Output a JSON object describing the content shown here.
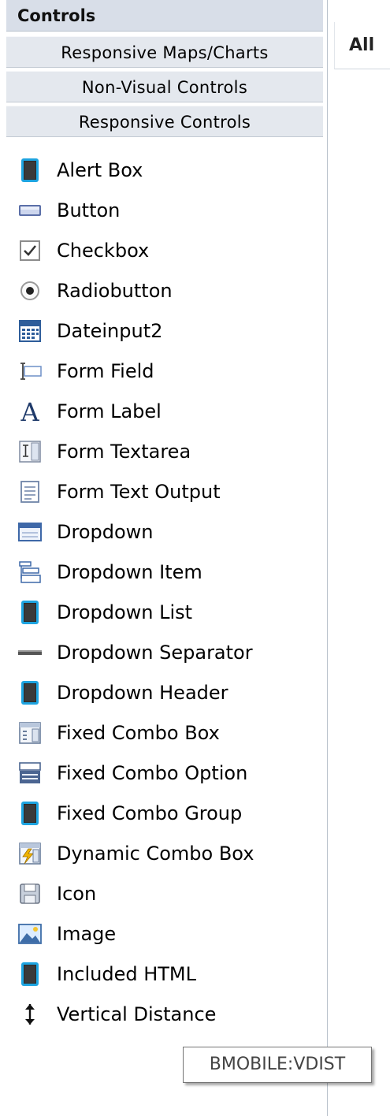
{
  "panel": {
    "title": "Controls",
    "sections": [
      {
        "label": "Responsive Maps/Charts"
      },
      {
        "label": "Non-Visual Controls"
      },
      {
        "label": "Responsive Controls"
      }
    ],
    "items": [
      {
        "label": "Alert Box",
        "icon": "phone-frame-icon"
      },
      {
        "label": "Button",
        "icon": "button-icon"
      },
      {
        "label": "Checkbox",
        "icon": "checkbox-icon"
      },
      {
        "label": "Radiobutton",
        "icon": "radio-icon"
      },
      {
        "label": "Dateinput2",
        "icon": "calendar-icon"
      },
      {
        "label": "Form Field",
        "icon": "text-field-icon"
      },
      {
        "label": "Form Label",
        "icon": "letter-a-icon"
      },
      {
        "label": "Form Textarea",
        "icon": "textarea-icon"
      },
      {
        "label": "Form Text Output",
        "icon": "text-output-icon"
      },
      {
        "label": "Dropdown",
        "icon": "dropdown-icon"
      },
      {
        "label": "Dropdown Item",
        "icon": "dropdown-item-icon"
      },
      {
        "label": "Dropdown List",
        "icon": "phone-frame-icon"
      },
      {
        "label": "Dropdown Separator",
        "icon": "separator-icon"
      },
      {
        "label": "Dropdown Header",
        "icon": "phone-frame-icon"
      },
      {
        "label": "Fixed Combo Box",
        "icon": "combo-box-icon"
      },
      {
        "label": "Fixed Combo Option",
        "icon": "combo-option-icon"
      },
      {
        "label": "Fixed Combo Group",
        "icon": "phone-frame-icon"
      },
      {
        "label": "Dynamic Combo Box",
        "icon": "dynamic-combo-icon"
      },
      {
        "label": "Icon",
        "icon": "floppy-disk-icon"
      },
      {
        "label": "Image",
        "icon": "image-icon"
      },
      {
        "label": "Included HTML",
        "icon": "phone-frame-icon"
      },
      {
        "label": "Vertical Distance",
        "icon": "vertical-arrow-icon"
      }
    ]
  },
  "right_pane": {
    "tab_label": "All"
  },
  "tooltip": {
    "text": "BMOBILE:VDIST"
  }
}
